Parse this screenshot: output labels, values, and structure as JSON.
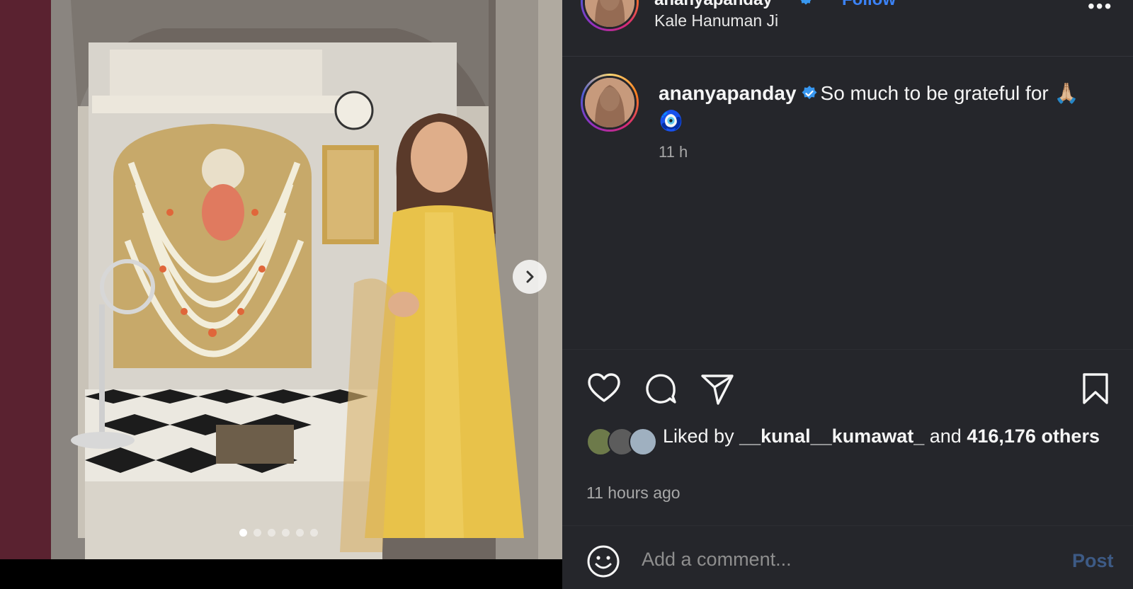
{
  "post": {
    "username": "ananyapanday",
    "follow_label": "Follow",
    "location": "Kale Hanuman Ji",
    "caption_text": "So much to be grateful for 🙏🏼",
    "caption_emoji": "🧿",
    "caption_age": "11 h",
    "more_label": "•••"
  },
  "carousel": {
    "slide_count": 6,
    "active_slide": 1,
    "next_icon": "chevron-right-icon"
  },
  "actions": {
    "like_icon": "heart-icon",
    "comment_icon": "comment-icon",
    "share_icon": "paper-plane-icon",
    "save_icon": "bookmark-icon"
  },
  "likes": {
    "prefix": "Liked by",
    "user": "__kunal__kumawat_",
    "middle": "and",
    "count": "416,176",
    "suffix": "others",
    "time_ago": "11 hours ago"
  },
  "comment_box": {
    "placeholder": "Add a comment...",
    "post_label": "Post",
    "emoji_icon": "smiley-icon"
  },
  "colors": {
    "sidebar_bg": "#25262b",
    "link_blue": "#3b82f6",
    "post_disabled": "#3d5a85",
    "verified_blue": "#3897f0"
  }
}
